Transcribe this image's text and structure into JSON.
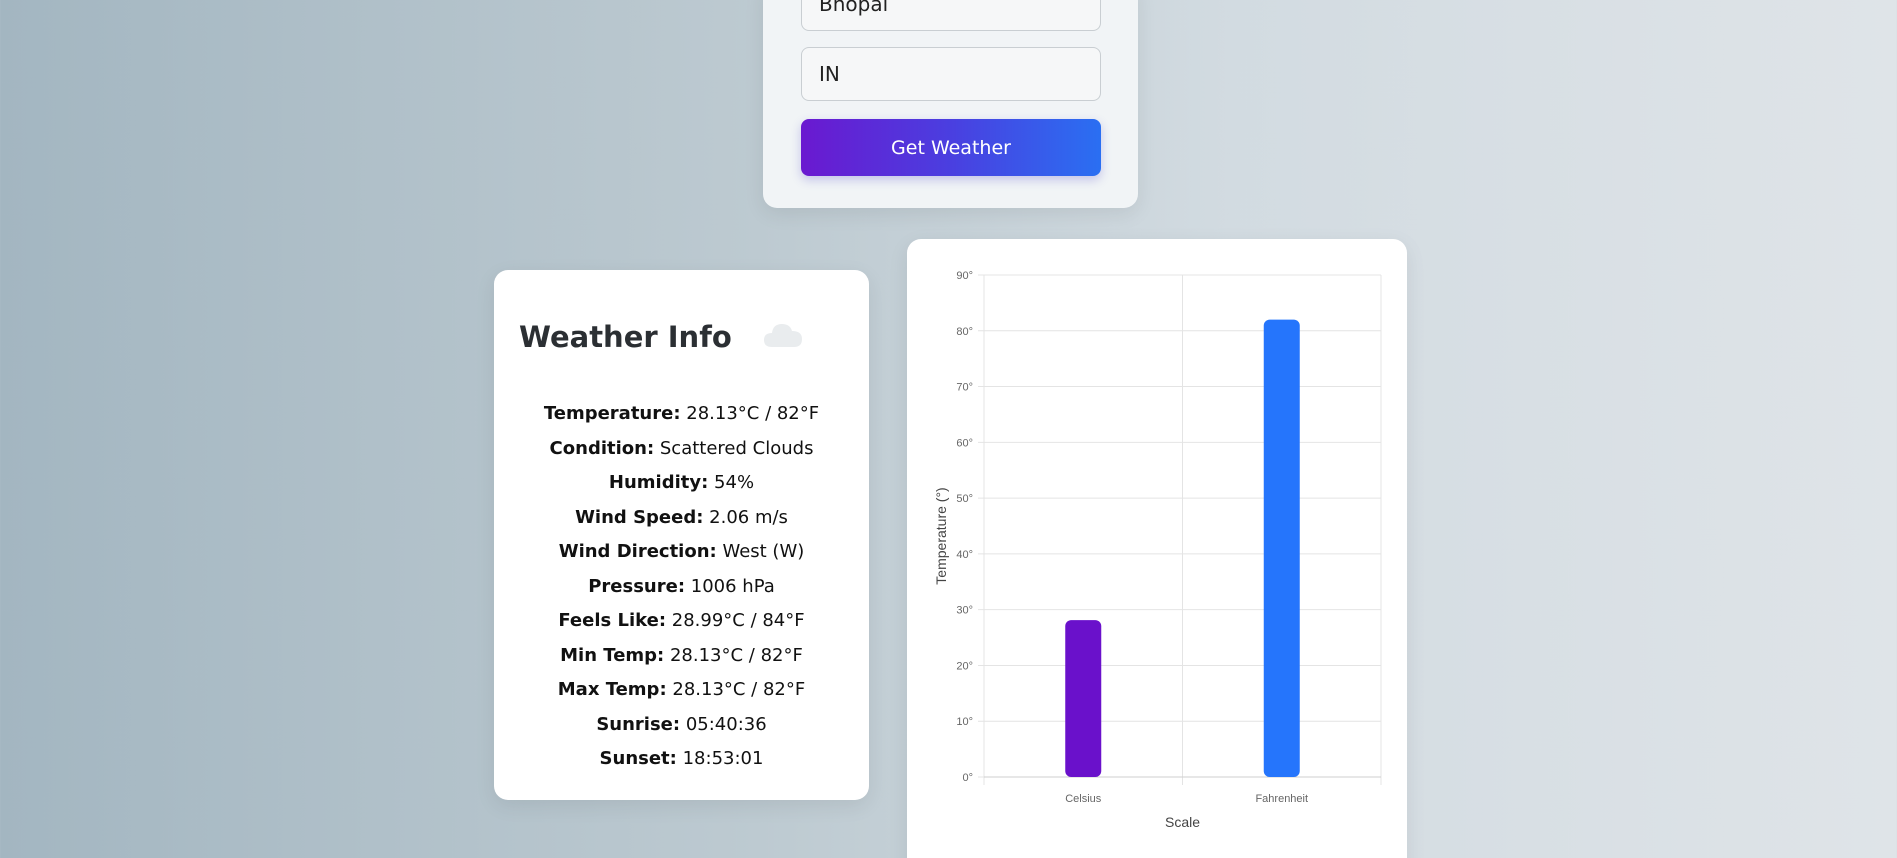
{
  "search": {
    "city_value": "Bhopal",
    "country_value": "IN",
    "button_label": "Get Weather"
  },
  "info": {
    "title": "Weather Info",
    "icon": "cloud-icon",
    "rows": [
      {
        "label": "Temperature:",
        "value": "28.13°C / 82°F"
      },
      {
        "label": "Condition:",
        "value": "Scattered Clouds"
      },
      {
        "label": "Humidity:",
        "value": "54%"
      },
      {
        "label": "Wind Speed:",
        "value": "2.06 m/s"
      },
      {
        "label": "Wind Direction:",
        "value": "West (W)"
      },
      {
        "label": "Pressure:",
        "value": "1006 hPa"
      },
      {
        "label": "Feels Like:",
        "value": "28.99°C / 84°F"
      },
      {
        "label": "Min Temp:",
        "value": "28.13°C / 82°F"
      },
      {
        "label": "Max Temp:",
        "value": "28.13°C / 82°F"
      },
      {
        "label": "Sunrise:",
        "value": "05:40:36"
      },
      {
        "label": "Sunset:",
        "value": "18:53:01"
      }
    ]
  },
  "chart_data": {
    "type": "bar",
    "categories": [
      "Celsius",
      "Fahrenheit"
    ],
    "values": [
      28.13,
      82
    ],
    "colors": [
      "#6a11cb",
      "#2575fc"
    ],
    "xlabel": "Scale",
    "ylabel": "Temperature (°)",
    "ylim": [
      0,
      90
    ],
    "yticks": [
      "0°",
      "10°",
      "20°",
      "30°",
      "40°",
      "50°",
      "60°",
      "70°",
      "80°",
      "90°"
    ],
    "grid": true
  }
}
